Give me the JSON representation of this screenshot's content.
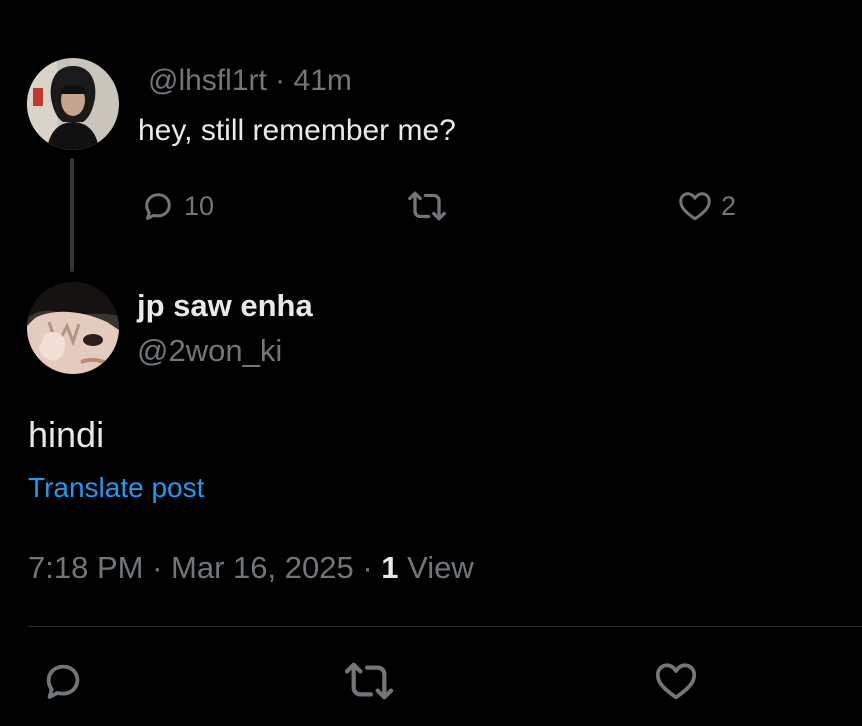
{
  "parent_post": {
    "handle": "@lhsfl1rt",
    "time_sep": "·",
    "time": "41m",
    "text": "hey, still remember me?",
    "actions": {
      "replies": "10",
      "reposts": "",
      "likes": "2"
    }
  },
  "post": {
    "display_name": "jp saw enha",
    "handle": "@2won_ki",
    "text": "hindi",
    "translate_label": "Translate post",
    "time": "7:18 PM",
    "sep1": "·",
    "date": "Mar 16, 2025",
    "sep2": "·",
    "views_count": "1",
    "views_label": "View"
  },
  "icons": {
    "reply": "reply-icon",
    "repost": "repost-icon",
    "like": "heart-icon"
  },
  "colors": {
    "background": "#000000",
    "text": "#e7e9ea",
    "muted": "#71767b",
    "link": "#1d9bf0"
  }
}
